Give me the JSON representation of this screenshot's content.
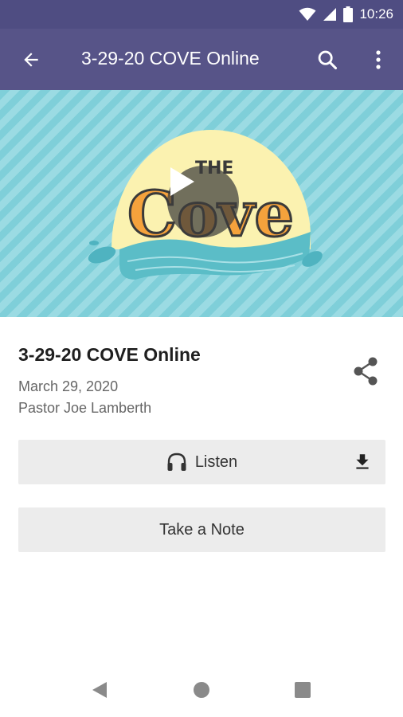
{
  "status_bar": {
    "time": "10:26",
    "icons": [
      "wifi-icon",
      "cell-signal-icon",
      "battery-icon"
    ],
    "background": "#4f4d82"
  },
  "app_bar": {
    "title": "3-29-20 COVE Online",
    "back_icon": "arrow-left-icon",
    "search_icon": "search-icon",
    "more_icon": "more-vertical-icon",
    "background": "#575488"
  },
  "hero": {
    "image_text": "THE COVE",
    "play_icon": "play-icon"
  },
  "sermon": {
    "title": "3-29-20 COVE Online",
    "date": "March 29, 2020",
    "speaker": "Pastor Joe Lamberth",
    "share_icon": "share-icon"
  },
  "actions": {
    "listen_label": "Listen",
    "listen_icon": "headphones-icon",
    "download_icon": "download-icon",
    "note_label": "Take a Note"
  },
  "nav_bar": {
    "icons": [
      "nav-back-icon",
      "nav-home-icon",
      "nav-recents-icon"
    ]
  }
}
